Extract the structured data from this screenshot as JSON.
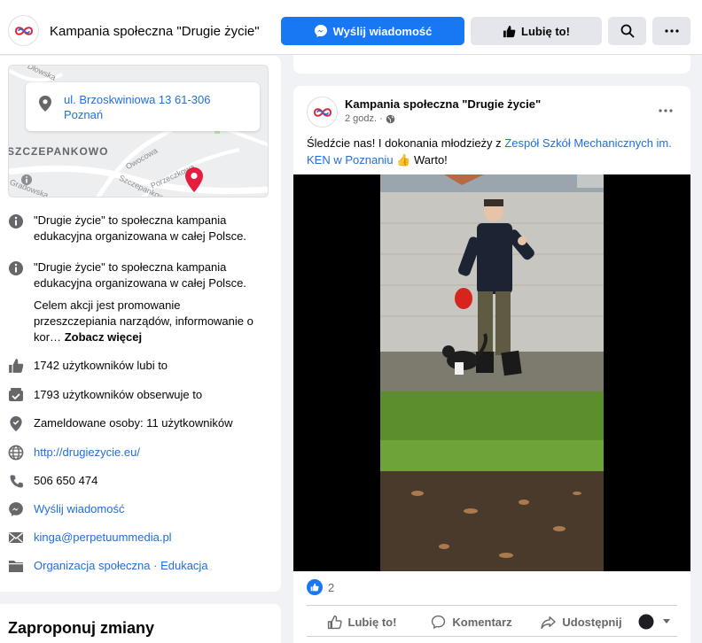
{
  "header": {
    "page_name": "Kampania społeczna \"Drugie życie\"",
    "send_message_label": "Wyślij wiadomość",
    "like_label": "Lubię to!",
    "search_icon": "search-icon",
    "more_icon": "more-icon"
  },
  "map": {
    "address_line1": "ul. Brzoskwiniowa 13 61-306",
    "address_line2": "Poznań",
    "labels": [
      "SZCZEPANKOWO",
      "Owocowa",
      "Porzeczkowa",
      "Szczepankowo",
      "Gradowska",
      "Dłowska"
    ]
  },
  "about": {
    "description_1": "\"Drugie życie\" to społeczna kampania edukacyjna organizowana w całej Polsce.",
    "description_2": "\"Drugie życie\" to społeczna kampania edukacyjna organizowana w całej Polsce.",
    "description_more": "Celem akcji jest promowanie przeszczepiania narządów, informowanie o kor…",
    "see_more": "Zobacz więcej",
    "likes": "1742 użytkowników lubi to",
    "followers": "1793 użytkowników obserwuje to",
    "checkins": "Zameldowane osoby: 11 użytkowników",
    "website": "http://drugiezycie.eu/",
    "phone": "506 650 474",
    "send_message": "Wyślij wiadomość",
    "email": "kinga@perpetuummedia.pl",
    "category": "Organizacja społeczna · Edukacja"
  },
  "suggest": {
    "title": "Zaproponuj zmiany"
  },
  "post": {
    "author": "Kampania społeczna \"Drugie życie\"",
    "time": "2 godz.",
    "text_before": "Śledźcie nas! I dokonania młodzieży z ",
    "text_link": "Zespół Szkół Mechanicznych im. KEN w Poznaniu",
    "text_emoji": "👍",
    "text_after": " Warto!",
    "reaction_count": "2",
    "actions": {
      "like": "Lubię to!",
      "comment": "Komentarz",
      "share": "Udostępnij"
    }
  },
  "colors": {
    "brand_blue": "#1877f2",
    "link_blue": "#216fdb",
    "map_pin": "#e41e3f"
  }
}
